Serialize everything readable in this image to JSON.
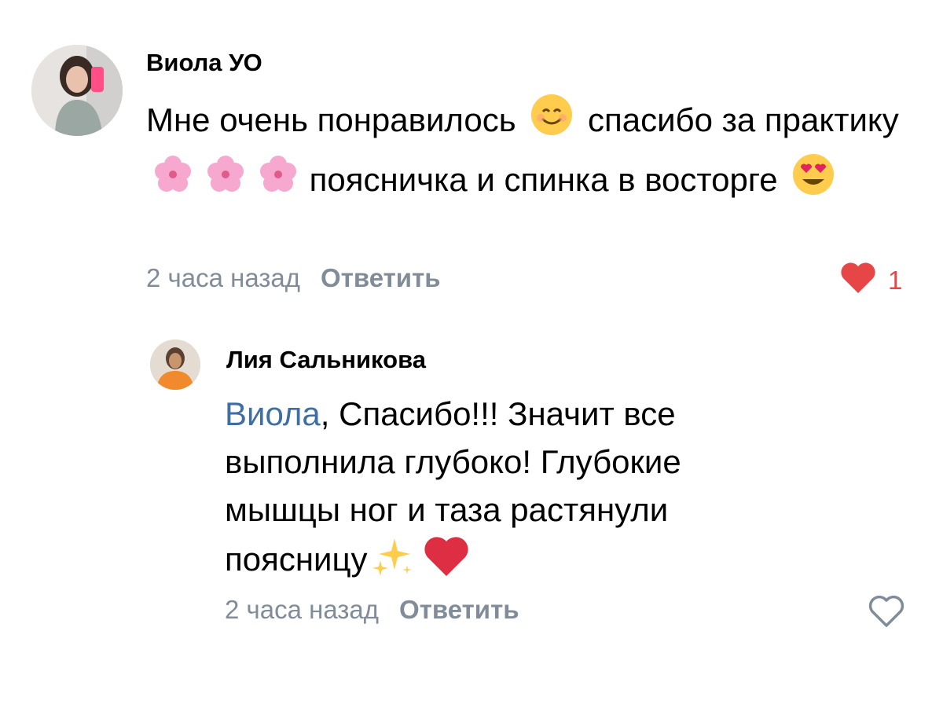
{
  "comments": [
    {
      "author": "Виола УО",
      "text_parts": [
        "Мне очень понравилось",
        "спасибо за практику",
        "поясничка и спинка в восторге"
      ],
      "emoji": [
        "smiling-face-emoji",
        "cherry-blossom-emoji",
        "heart-eyes-emoji"
      ],
      "time": "2 часа назад",
      "reply_label": "Ответить",
      "likes": "1",
      "liked": true
    },
    {
      "author": "Лия Сальникова",
      "mention": "Виола",
      "text_parts": [
        ", Спасибо!!! Значит все",
        "выполнила глубоко! Глубокие",
        "мышцы ног и таза растянули",
        "поясницу"
      ],
      "emoji": [
        "sparkles-emoji",
        "red-heart-emoji"
      ],
      "time": "2 часа назад",
      "reply_label": "Ответить",
      "liked": false
    }
  ],
  "colors": {
    "meta_gray": "#818c99",
    "mention_blue": "#3f6ea5",
    "like_red": "#e64646"
  }
}
